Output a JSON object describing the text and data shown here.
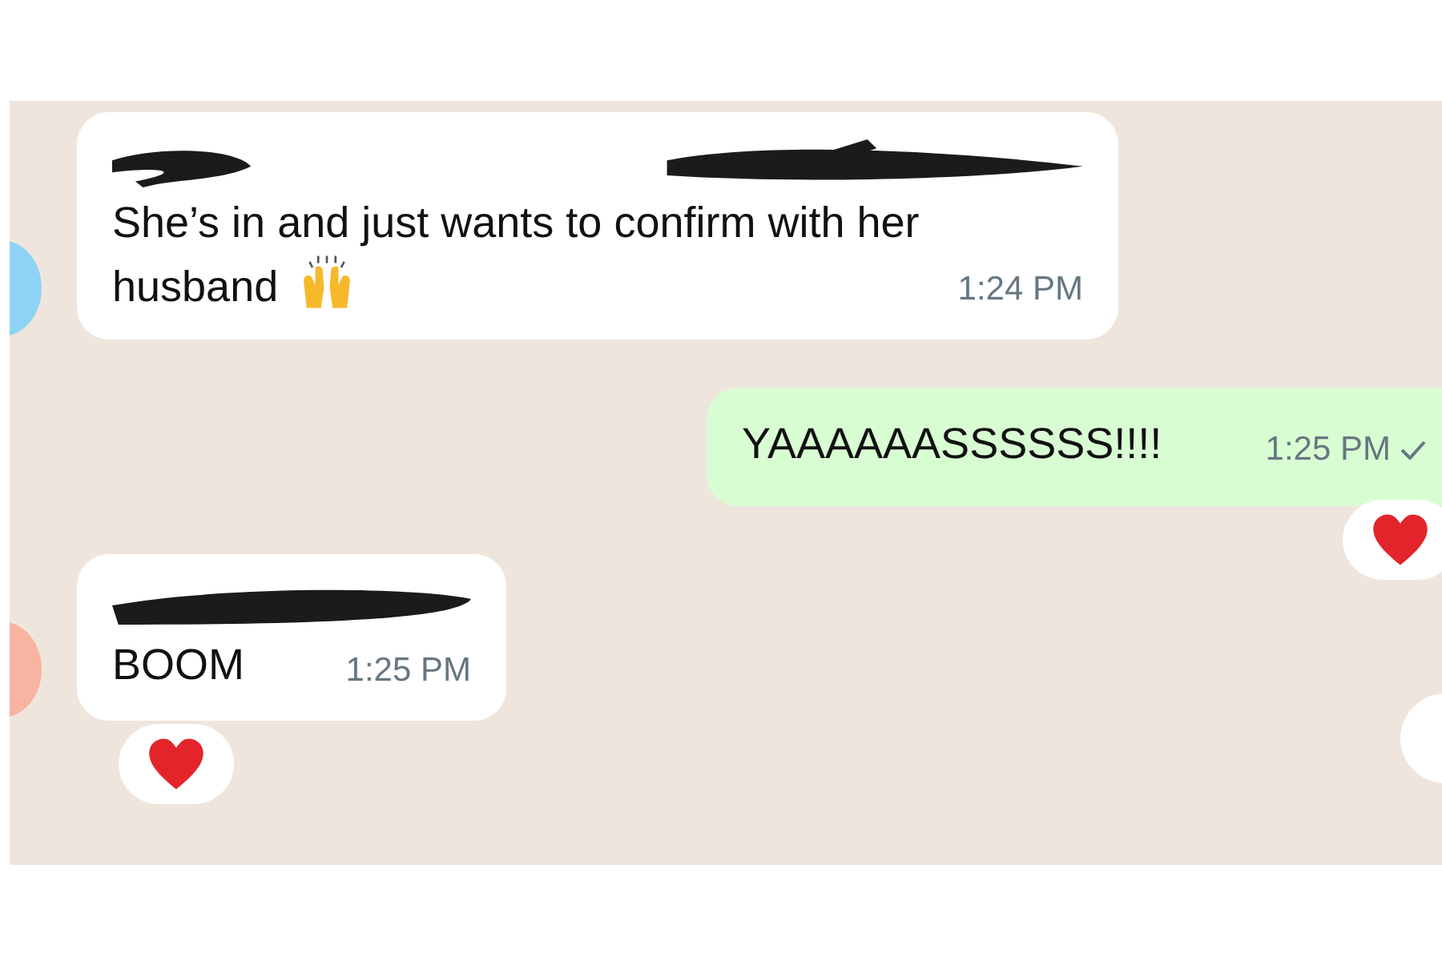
{
  "messages": [
    {
      "kind": "incoming",
      "color": "#8fd3f4",
      "redacted": true,
      "text": "She’s in and just wants to confirm with her husband",
      "has_emoji": true,
      "time": "1:24 PM",
      "read": false,
      "reacted": false
    },
    {
      "kind": "outgoing",
      "redacted": false,
      "text": "YAAAAAASSSSSS!!!!",
      "has_emoji": false,
      "time": "1:25 PM",
      "read": true,
      "reacted": true
    },
    {
      "kind": "incoming",
      "color": "#f8b4a0",
      "redacted": true,
      "text": "BOOM",
      "has_emoji": false,
      "time": "1:25 PM",
      "read": false,
      "reacted": true
    }
  ]
}
